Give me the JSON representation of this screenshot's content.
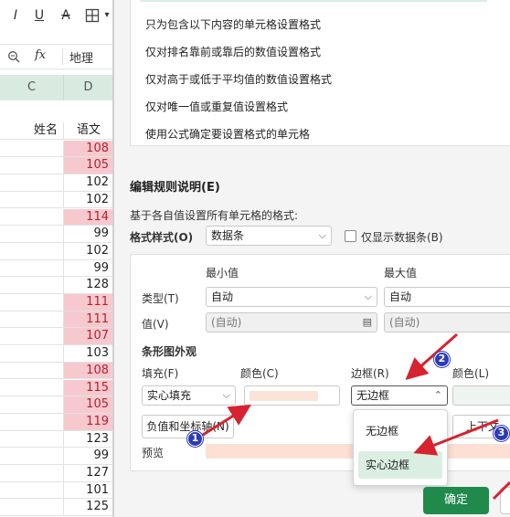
{
  "toolbar": {
    "underline_label": "U",
    "strike_label": "A",
    "fx_label": "fx",
    "formula_value": "地理"
  },
  "sheet": {
    "col_c": "C",
    "col_d": "D",
    "header_name": "姓名",
    "header_score": "语文",
    "scores": [
      "108",
      "105",
      "102",
      "102",
      "114",
      "99",
      "102",
      "99",
      "128",
      "111",
      "111",
      "107",
      "103",
      "108",
      "115",
      "105",
      "119",
      "123",
      "99",
      "127",
      "101",
      "125"
    ],
    "highlight": [
      true,
      true,
      false,
      false,
      true,
      false,
      false,
      false,
      false,
      true,
      true,
      true,
      false,
      true,
      true,
      true,
      true,
      false,
      false,
      false,
      false,
      false
    ]
  },
  "rules": {
    "items": [
      "只为包含以下内容的单元格设置格式",
      "仅对排名靠前或靠后的数值设置格式",
      "仅对高于或低于平均值的数值设置格式",
      "仅对唯一值或重复值设置格式",
      "使用公式确定要设置格式的单元格"
    ]
  },
  "edit": {
    "title": "编辑规则说明(E)",
    "subtitle": "基于各自值设置所有单元格的格式:",
    "format_style_label": "格式样式(O)",
    "format_style_value": "数据条",
    "show_bar_only_label": "仅显示数据条(B)",
    "min_label": "最小值",
    "max_label": "最大值",
    "type_label": "类型(T)",
    "value_label": "值(V)",
    "min_type": "自动",
    "max_type": "自动",
    "min_value": "(自动)",
    "max_value": "(自动)",
    "bar_appearance": "条形图外观",
    "fill_label": "填充(F)",
    "color_label": "颜色(C)",
    "border_label": "边框(R)",
    "border_color_label": "颜色(L)",
    "fill_value": "实心填充",
    "border_value": "无边框",
    "negative_axis_button": "负值和坐标轴(N)",
    "direction_button": "上下文",
    "preview_label": "预览",
    "bar_color": "#fde0d3"
  },
  "border_dropdown": {
    "options": [
      "无边框",
      "实心边框"
    ],
    "selected": "实心边框"
  },
  "buttons": {
    "ok": "确定"
  },
  "badges": [
    "1",
    "2",
    "3"
  ]
}
